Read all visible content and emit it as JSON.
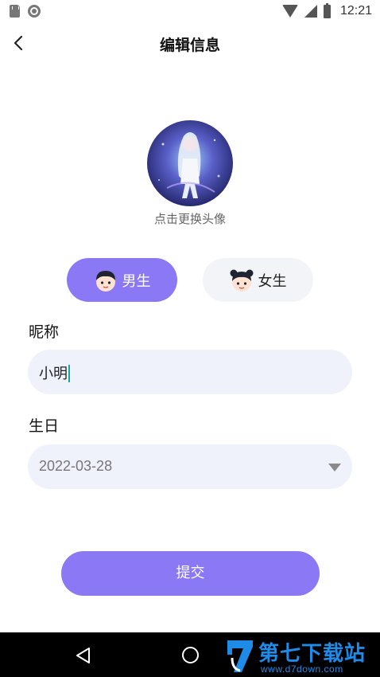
{
  "status_bar": {
    "time": "12:21",
    "icons": [
      "sd-card-icon",
      "circle-notification-icon",
      "wifi-icon",
      "signal-icon",
      "battery-icon"
    ]
  },
  "header": {
    "title": "编辑信息",
    "back_icon": "chevron-left-icon"
  },
  "avatar": {
    "hint": "点击更换头像"
  },
  "gender": {
    "selected": "male",
    "male_label": "男生",
    "female_label": "女生",
    "active_color": "#8a78f4",
    "inactive_color": "#f3f4f8"
  },
  "form": {
    "nickname_label": "昵称",
    "nickname_value": "小明",
    "birthday_label": "生日",
    "birthday_value": "2022-03-28"
  },
  "submit_label": "提交",
  "nav_bar": {
    "icons": [
      "back-triangle-icon",
      "home-circle-icon"
    ]
  },
  "watermark": {
    "title": "第七下载站",
    "url": "www.d7down.com",
    "color": "#1e8be6"
  },
  "colors": {
    "accent": "#8a78f4",
    "input_bg": "#eff1fb",
    "caret": "#1aa3a3"
  }
}
